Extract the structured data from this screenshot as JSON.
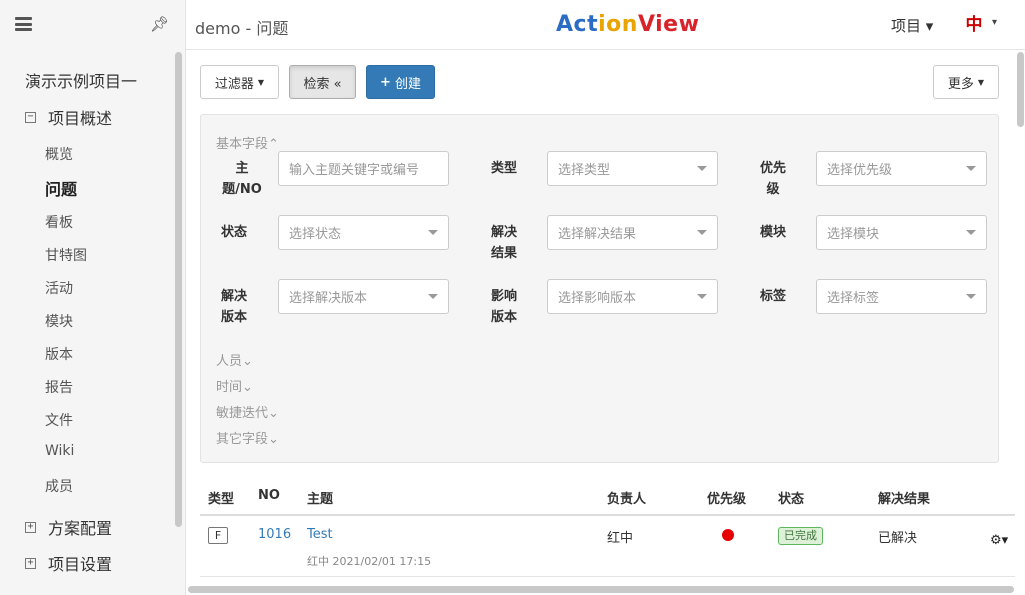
{
  "header": {
    "breadcrumb": "demo - 问题",
    "logo": "ActionView",
    "project_menu": "项目 ▾",
    "avatar": "中"
  },
  "sidebar": {
    "project_name": "演示示例项目一",
    "overview_section": "项目概述",
    "items": [
      "概览",
      "问题",
      "看板",
      "甘特图",
      "活动",
      "模块",
      "版本",
      "报告",
      "文件",
      "Wiki",
      "成员"
    ],
    "active_item": "问题",
    "scheme_section": "方案配置",
    "settings_section": "项目设置"
  },
  "toolbar": {
    "filter": "过滤器",
    "search": "检索 «",
    "create": "创建",
    "more": "更多"
  },
  "filters": {
    "basic_title": "基本字段⌃",
    "labels": {
      "subject": "主\n题/NO",
      "type": "类型",
      "priority": "优先\n级",
      "status": "状态",
      "resolution": "解决\n结果",
      "module": "模块",
      "resolve_version": "解决\n版本",
      "affect_version": "影响\n版本",
      "tag": "标签"
    },
    "placeholders": {
      "subject": "输入主题关键字或编号",
      "type": "选择类型",
      "priority": "选择优先级",
      "status": "选择状态",
      "resolution": "选择解决结果",
      "module": "选择模块",
      "resolve_version": "选择解决版本",
      "affect_version": "选择影响版本",
      "tag": "选择标签"
    },
    "groups": [
      "人员⌄",
      "时间⌄",
      "敏捷迭代⌄",
      "其它字段⌄"
    ]
  },
  "table": {
    "headers": [
      "类型",
      "NO",
      "主题",
      "负责人",
      "优先级",
      "状态",
      "解决结果"
    ],
    "rows": [
      {
        "type": "F",
        "no": "1016",
        "subject": "Test",
        "meta": "红中  2021/02/01 17:15",
        "assignee": "红中",
        "priority_color": "#e60000",
        "status": "已完成",
        "resolution": "已解决"
      }
    ]
  },
  "colors": {
    "primary": "#337ab7",
    "logo_a": "#2b6cc4",
    "logo_c": "#e8a400",
    "logo_v": "#d9232b",
    "status_green": "#5cb85c"
  }
}
